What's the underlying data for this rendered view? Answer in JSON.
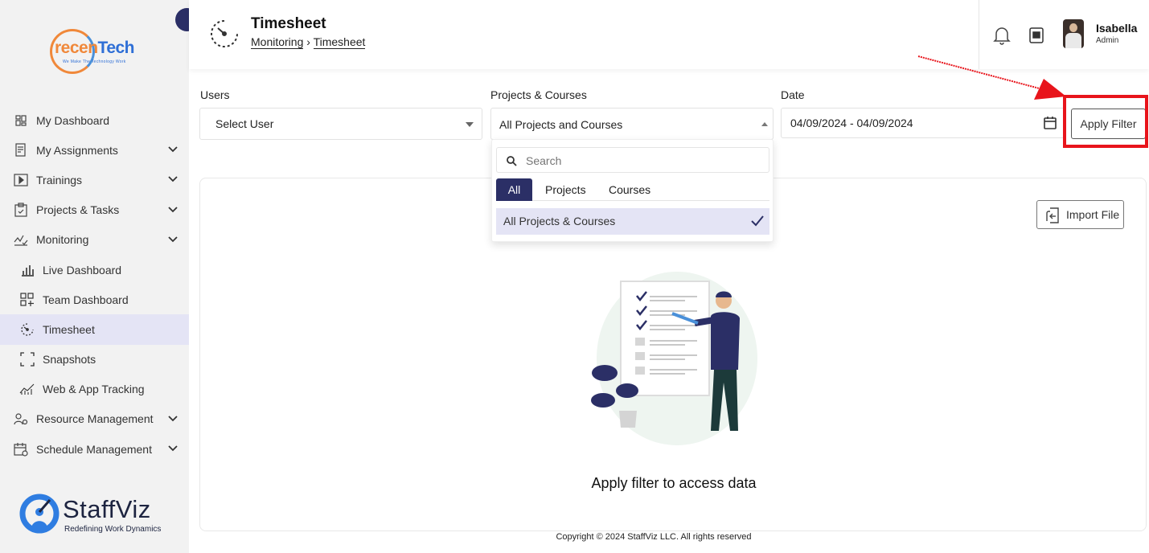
{
  "brand": {
    "logo_word_a": "recen",
    "logo_word_b": "Tech",
    "logo_tagline": "We Make The Technology Work",
    "footer_logo": "StaffViz",
    "footer_tagline": "Redefining Work Dynamics"
  },
  "sidebar": {
    "items": [
      {
        "label": "My Dashboard",
        "icon": "dashboard-icon",
        "chevron": false
      },
      {
        "label": "My Assignments",
        "icon": "assignments-icon",
        "chevron": true
      },
      {
        "label": "Trainings",
        "icon": "play-icon",
        "chevron": true
      },
      {
        "label": "Projects & Tasks",
        "icon": "clipboard-icon",
        "chevron": true
      },
      {
        "label": "Monitoring",
        "icon": "monitoring-icon",
        "chevron": true
      },
      {
        "label": "Live Dashboard",
        "icon": "bar-chart-icon",
        "sub": true
      },
      {
        "label": "Team Dashboard",
        "icon": "grid-plus-icon",
        "sub": true
      },
      {
        "label": "Timesheet",
        "icon": "timer-icon",
        "sub": true,
        "active": true
      },
      {
        "label": "Snapshots",
        "icon": "frame-icon",
        "sub": true
      },
      {
        "label": "Web & App Tracking",
        "icon": "line-chart-icon",
        "sub": true
      },
      {
        "label": "Resource Management",
        "icon": "resource-icon",
        "chevron": true
      },
      {
        "label": "Schedule Management",
        "icon": "schedule-icon",
        "chevron": true
      }
    ]
  },
  "header": {
    "title": "Timesheet",
    "breadcrumb_1": "Monitoring",
    "breadcrumb_sep": "›",
    "breadcrumb_2": "Timesheet",
    "user_name": "Isabella",
    "user_role": "Admin"
  },
  "filters": {
    "users_label": "Users",
    "users_value": "Select User",
    "projects_label": "Projects & Courses",
    "projects_value": "All Projects and Courses",
    "date_label": "Date",
    "date_value": "04/09/2024 - 04/09/2024",
    "apply_label": "Apply Filter"
  },
  "dropdown": {
    "search_placeholder": "Search",
    "tabs": [
      "All",
      "Projects",
      "Courses"
    ],
    "active_tab": "All",
    "option": "All Projects & Courses"
  },
  "main": {
    "import_label": "Import File",
    "empty_text": "Apply filter to access data"
  },
  "footer": {
    "copyright": "Copyright © 2024 StaffViz LLC. All rights reserved"
  },
  "colors": {
    "primary": "#2b2f66",
    "active_bg": "#e4e4f5",
    "annotation_red": "#e8141b",
    "sidebar_bg": "#f2f2f2"
  }
}
